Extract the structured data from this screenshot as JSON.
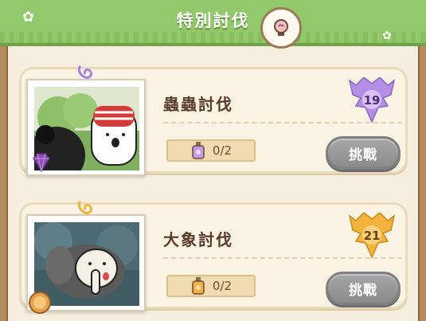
{
  "header": {
    "title": "特別討伐"
  },
  "cards": [
    {
      "name": "蟲蟲討伐",
      "progress": "0/2",
      "button": "挑戰",
      "level": "19",
      "badge_color": "#b58ee6"
    },
    {
      "name": "大象討伐",
      "progress": "0/2",
      "button": "挑戰",
      "level": "21",
      "badge_color": "#f2b23c"
    }
  ]
}
